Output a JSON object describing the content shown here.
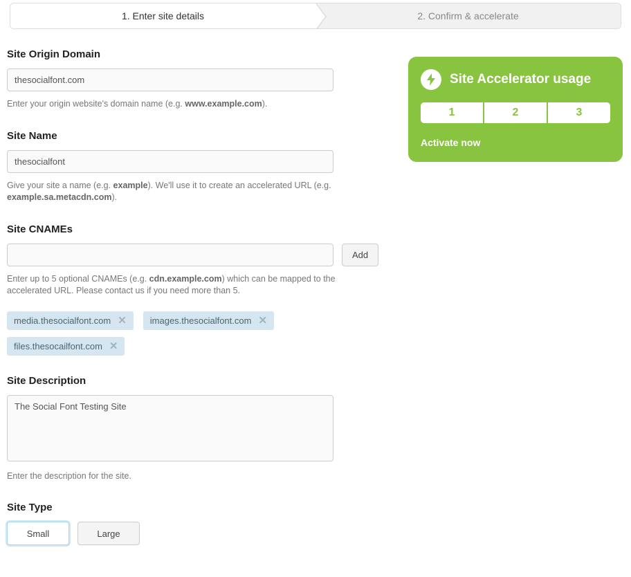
{
  "steps": {
    "step1": "1. Enter site details",
    "step2": "2. Confirm & accelerate"
  },
  "origin": {
    "label": "Site Origin Domain",
    "value": "thesocialfont.com",
    "help_pre": "Enter your origin website's domain name (e.g. ",
    "help_bold": "www.example.com",
    "help_post": ")."
  },
  "sitename": {
    "label": "Site Name",
    "value": "thesocialfont",
    "help_pre": "Give your site a name (e.g. ",
    "help_bold1": "example",
    "help_mid": "). We'll use it to create an accelerated URL (e.g. ",
    "help_bold2": "example.sa.metacdn.com",
    "help_post": ")."
  },
  "cnames": {
    "label": "Site CNAMEs",
    "add_label": "Add",
    "help_pre": "Enter up to 5 optional CNAMEs (e.g. ",
    "help_bold": "cdn.example.com",
    "help_post": ") which can be mapped to the accelerated URL. Please contact us if you need more than 5.",
    "tags": [
      "media.thesocialfont.com",
      "images.thesocialfont.com",
      "files.thesocailfont.com"
    ]
  },
  "description": {
    "label": "Site Description",
    "value": "The Social Font Testing Site",
    "help": "Enter the description for the site."
  },
  "sitetype": {
    "label": "Site Type",
    "small": "Small",
    "large": "Large"
  },
  "widget": {
    "title": "Site Accelerator usage",
    "segments": [
      "1",
      "2",
      "3"
    ],
    "activate": "Activate now"
  }
}
